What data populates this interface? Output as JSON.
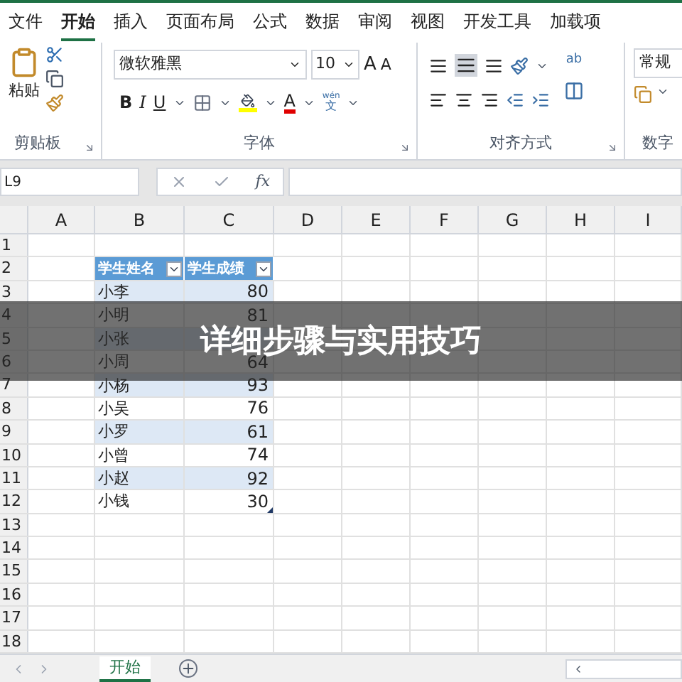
{
  "menu_tabs": [
    {
      "label": "文件",
      "selected": false
    },
    {
      "label": "开始",
      "selected": true
    },
    {
      "label": "插入",
      "selected": false
    },
    {
      "label": "页面布局",
      "selected": false
    },
    {
      "label": "公式",
      "selected": false
    },
    {
      "label": "数据",
      "selected": false
    },
    {
      "label": "审阅",
      "selected": false
    },
    {
      "label": "视图",
      "selected": false
    },
    {
      "label": "开发工具",
      "selected": false
    },
    {
      "label": "加载项",
      "selected": false
    }
  ],
  "ribbon": {
    "clipboard": {
      "paste_label": "粘贴",
      "group_label": "剪贴板"
    },
    "font": {
      "name": "微软雅黑",
      "size": "10",
      "grow": "A",
      "shrink": "A",
      "bold": "B",
      "italic": "I",
      "underline": "U",
      "font_color": "A",
      "phonetic_top": "wén",
      "phonetic_bottom": "文",
      "group_label": "字体"
    },
    "alignment": {
      "wrap_top": "ab",
      "group_label": "对齐方式"
    },
    "number": {
      "format": "常规",
      "group_label": "数字"
    }
  },
  "formula_bar": {
    "name_box": "L9",
    "fx": "fx"
  },
  "columns": [
    "A",
    "B",
    "C",
    "D",
    "E",
    "F",
    "G",
    "H",
    "I"
  ],
  "rows": [
    {
      "number": "1",
      "kind": "empty"
    },
    {
      "number": "2",
      "kind": "header",
      "name": "学生姓名",
      "score": "学生成绩"
    },
    {
      "number": "3",
      "kind": "data",
      "name": "小李",
      "score": "80",
      "banded": true
    },
    {
      "number": "4",
      "kind": "data",
      "name": "小明",
      "score": "81",
      "banded": false
    },
    {
      "number": "5",
      "kind": "data",
      "name": "小张",
      "banded": true
    },
    {
      "number": "6",
      "kind": "data",
      "name": "小周",
      "score": "64",
      "banded": false
    },
    {
      "number": "7",
      "kind": "data",
      "name": "小杨",
      "score": "93",
      "banded": true
    },
    {
      "number": "8",
      "kind": "data",
      "name": "小吴",
      "score": "76",
      "banded": false
    },
    {
      "number": "9",
      "kind": "data",
      "name": "小罗",
      "score": "61",
      "banded": true
    },
    {
      "number": "10",
      "kind": "data",
      "name": "小曾",
      "score": "74",
      "banded": false
    },
    {
      "number": "11",
      "kind": "data",
      "name": "小赵",
      "score": "92",
      "banded": true
    },
    {
      "number": "12",
      "kind": "data",
      "name": "小钱",
      "score": "30",
      "banded": false
    },
    {
      "number": "13",
      "kind": "empty"
    },
    {
      "number": "14",
      "kind": "empty"
    },
    {
      "number": "15",
      "kind": "empty"
    },
    {
      "number": "16",
      "kind": "empty"
    },
    {
      "number": "17",
      "kind": "empty"
    },
    {
      "number": "18",
      "kind": "empty"
    }
  ],
  "banner": "详细步骤与实用技巧",
  "sheet_tabs": [
    {
      "label": "开始",
      "selected": true
    }
  ]
}
